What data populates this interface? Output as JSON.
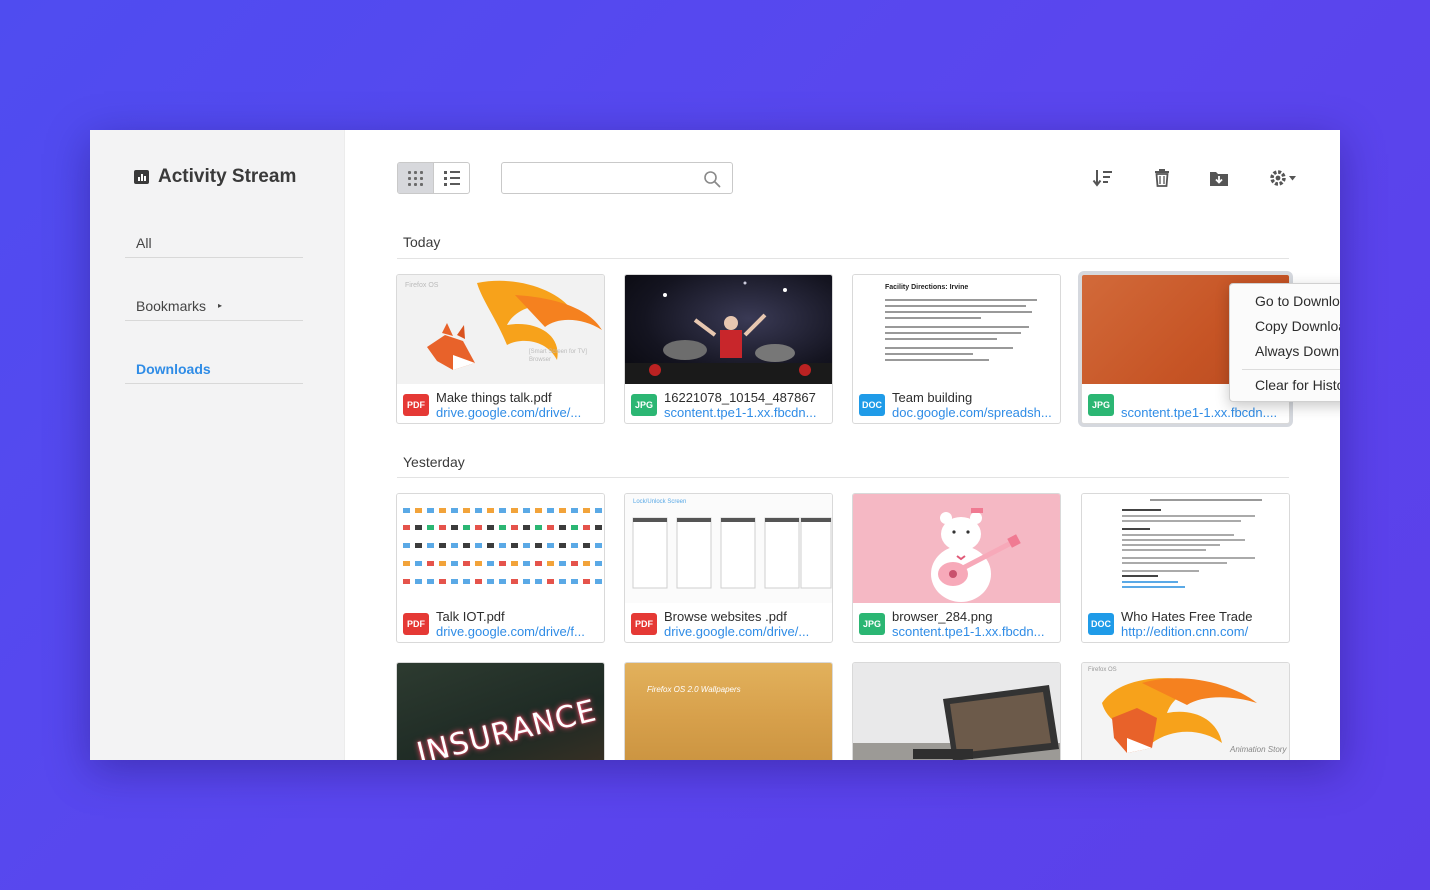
{
  "sidebar": {
    "title": "Activity Stream",
    "items": [
      {
        "label": "All"
      },
      {
        "label": "Bookmarks",
        "caret": "▸"
      },
      {
        "label": "Downloads",
        "active": true
      }
    ]
  },
  "toolbar": {
    "search_placeholder": "",
    "icons": [
      "grid-view-icon",
      "list-view-icon",
      "search-icon",
      "sort-icon",
      "trash-icon",
      "download-folder-icon",
      "settings-gear-icon"
    ]
  },
  "sections": [
    {
      "label": "Today",
      "items": [
        {
          "badge": "PDF",
          "name": "Make things talk.pdf",
          "url": "drive.google.com/drive/..."
        },
        {
          "badge": "JPG",
          "name": "16221078_10154_487867",
          "url": "scontent.tpe1-1.xx.fbcdn..."
        },
        {
          "badge": "DOC",
          "name": "Team building",
          "url": "doc.google.com/spreadsh..."
        },
        {
          "badge": "JPG",
          "name": "",
          "url": "scontent.tpe1-1.xx.fbcdn...."
        }
      ]
    },
    {
      "label": "Yesterday",
      "items": [
        {
          "badge": "PDF",
          "name": "Talk IOT.pdf",
          "url": "drive.google.com/drive/f..."
        },
        {
          "badge": "PDF",
          "name": "Browse websites .pdf",
          "url": "drive.google.com/drive/..."
        },
        {
          "badge": "JPG",
          "name": "browser_284.png",
          "url": "scontent.tpe1-1.xx.fbcdn..."
        },
        {
          "badge": "DOC",
          "name": "Who Hates Free Trade",
          "url": "http://edition.cnn.com/"
        }
      ]
    }
  ],
  "third_row": [
    {
      "thumb_text": "INSURANCE"
    },
    {
      "thumb_text": "Firefox OS 2.0 Wallpapers"
    },
    {
      "thumb_text": ""
    },
    {
      "thumb_text": "Animation Story"
    }
  ],
  "thumb_texts": {
    "firefox_os": "Firefox OS",
    "smart_screen": "[Smart Screen for TV] Browser",
    "facility": "Facility Directions: Irvine",
    "firefox_os_small": "Firefox OS",
    "lock_unlock": "Lock/Unlock Screen"
  },
  "context_menu": {
    "items": [
      "Go to Download Page",
      "Copy Download Link",
      "Always Download and Open This file Type"
    ],
    "clear": "Clear for History",
    "more_label": "•••"
  },
  "colors": {
    "background": "#5249ef",
    "accent": "#2f8ce6",
    "pdf": "#e53935",
    "jpg": "#2bb673",
    "doc": "#1f9be8"
  }
}
